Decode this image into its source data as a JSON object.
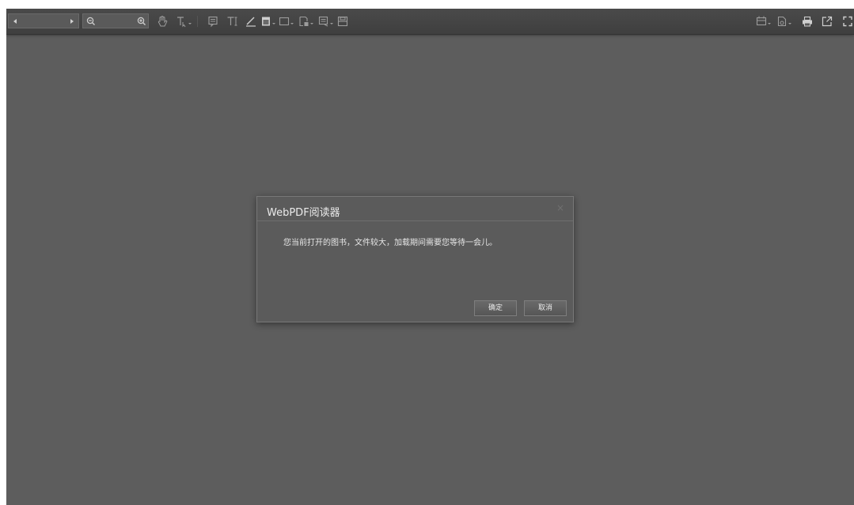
{
  "dialog": {
    "title": "WebPDF阅读器",
    "close_symbol": "×",
    "message": "您当前打开的图书，文件较大，加载期间需要您等待一会儿。",
    "ok_label": "确定",
    "cancel_label": "取消"
  },
  "toolbar": {
    "icons": [
      "prev-page-icon",
      "next-page-icon",
      "zoom-out-icon",
      "zoom-in-icon",
      "hand-tool-icon",
      "text-select-icon",
      "comment-icon",
      "typewriter-icon",
      "pen-icon",
      "highlight-icon",
      "rectangle-icon",
      "stamp-icon",
      "note-icon",
      "save-icon",
      "bookmark-icon",
      "file-icon",
      "print-icon",
      "open-external-icon",
      "fullscreen-icon"
    ]
  },
  "colors": {
    "background": "#5d5d5d",
    "toolbar": "#444444",
    "dialog": "#5b5b5b",
    "text": "#e6e6e6"
  }
}
